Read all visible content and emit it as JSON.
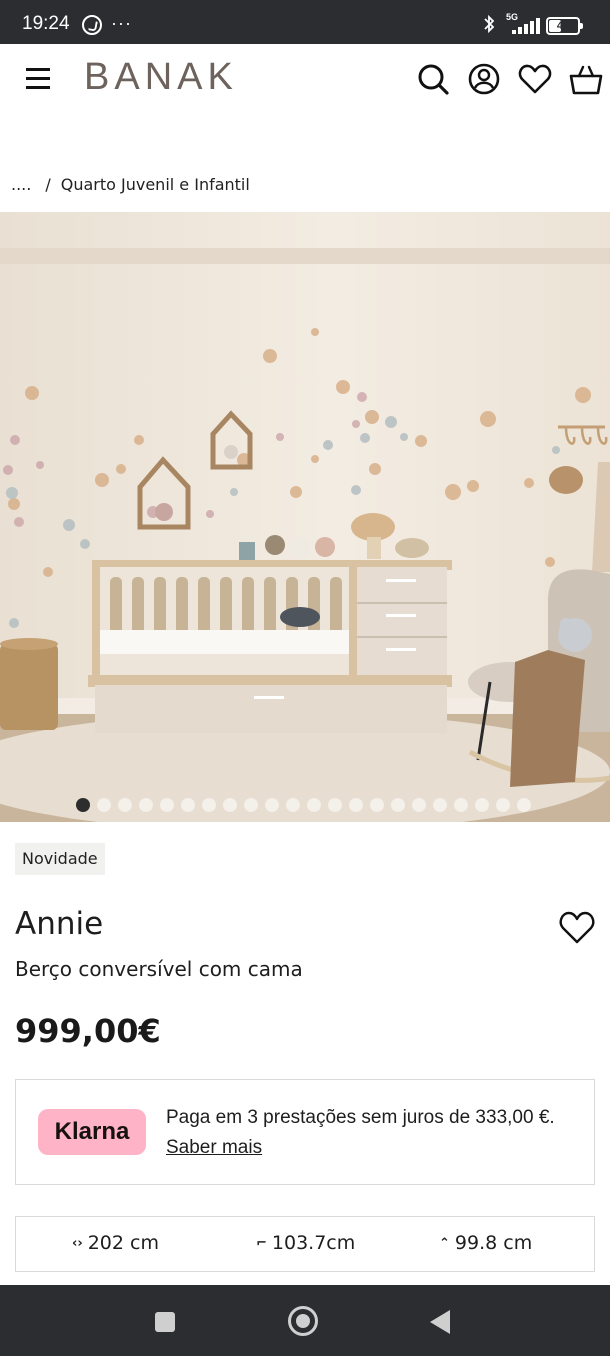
{
  "status_bar": {
    "time": "19:24",
    "more": "···",
    "network": "5G",
    "battery": "42",
    "battery_level": 0.42
  },
  "header": {
    "logo": "BANAK",
    "icons": [
      "menu-icon",
      "search-icon",
      "account-icon",
      "wishlist-icon",
      "bag-icon"
    ]
  },
  "breadcrumb": {
    "ellipsis": "....",
    "separator": "/",
    "current": "Quarto Juvenil e Infantil"
  },
  "gallery": {
    "slide_count": 22,
    "active_index": 0,
    "colors": {
      "wall": "#efe7dc",
      "floor": "#c9b49c",
      "wood": "#d8c2a2",
      "panel": "#e6dcd1"
    }
  },
  "product": {
    "badge": "Novidade",
    "name": "Annie",
    "subtitle": "Berço conversível com cama",
    "price": "999,00€"
  },
  "klarna": {
    "logo": "Klarna",
    "text": "Paga em 3 prestações sem juros de 333,00 €.",
    "link": "Saber mais",
    "brand_color": "#ffb3c7"
  },
  "dimensions": {
    "width": "202 cm",
    "depth": "103.7cm",
    "height": "99.8 cm",
    "icons": [
      "width-arrows-icon",
      "depth-icon",
      "height-arrows-icon"
    ]
  },
  "nav_bar": {
    "buttons": [
      "recents-button",
      "home-button",
      "back-button"
    ]
  }
}
